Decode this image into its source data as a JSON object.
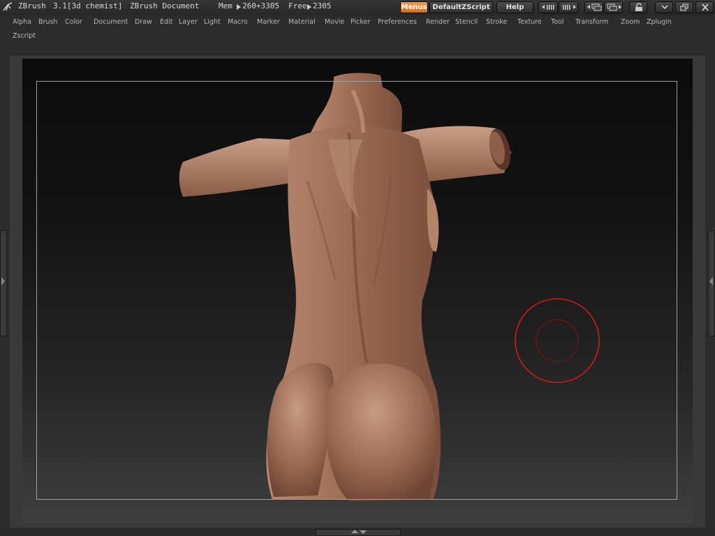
{
  "titlebar": {
    "app_name": "ZBrush",
    "version": "3.1[3d chemist]",
    "document": "ZBrush Document",
    "mem_label": "Mem",
    "mem_value": "260+3305",
    "free_label": "Free",
    "free_value": "2305",
    "menus_button": "Menus",
    "script_button": "DefaultZScript",
    "help_button": "Help"
  },
  "menubar": {
    "items": [
      "Alpha",
      "Brush",
      "Color",
      "Document",
      "Draw",
      "Edit",
      "Layer",
      "Light",
      "Macro",
      "Marker",
      "Material",
      "Movie",
      "Picker",
      "Preferences",
      "Render",
      "Stencil",
      "Stroke",
      "Texture",
      "Tool",
      "Transform",
      "Zoom",
      "Zplugin",
      "Zscript"
    ]
  },
  "icons": {
    "logo": "zbrush-logo-icon",
    "arrow": "triangle-right-icon",
    "toolbar": [
      "tray-shrink-icon",
      "tray-expand-icon",
      "palette-left-icon",
      "palette-right-icon",
      "lock-icon",
      "minimize-icon",
      "maximize-icon",
      "close-icon"
    ]
  },
  "colors": {
    "accent": "#f08420",
    "brush_cursor": "#cc1a1a",
    "skin_base": "#9a6a52"
  }
}
